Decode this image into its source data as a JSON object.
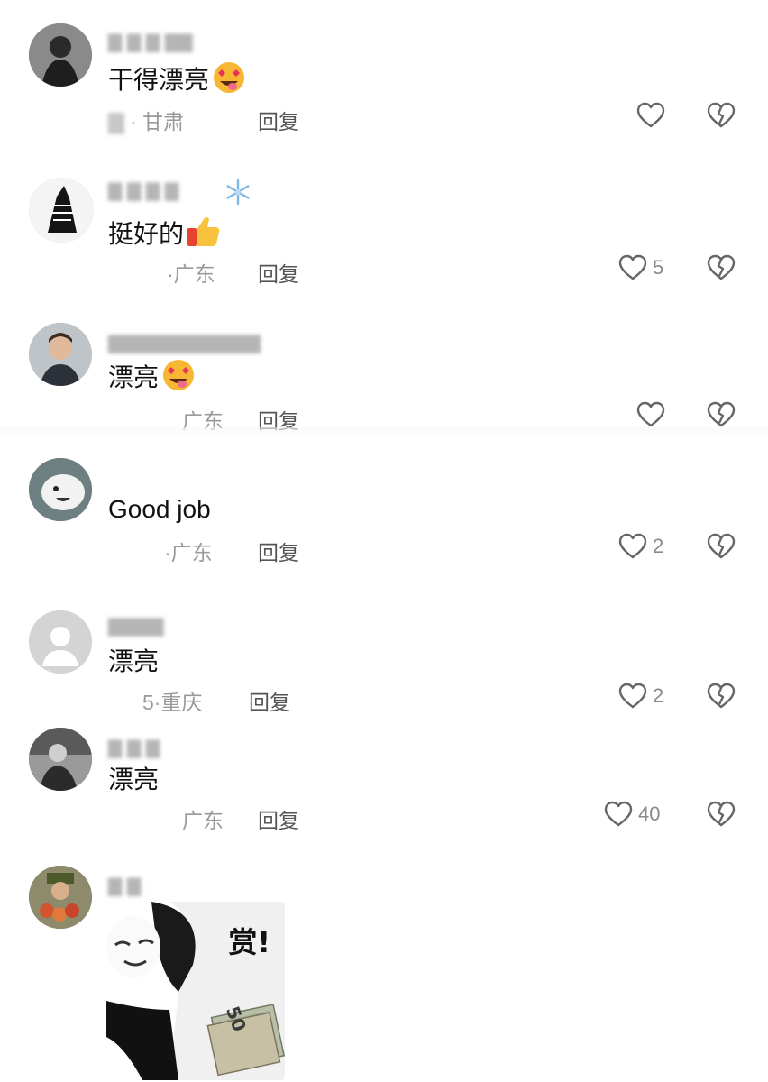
{
  "comments": [
    {
      "username": "▇ ▇ ▇ ▇▇",
      "text": "干得漂亮",
      "emoji": "heart-eyes-tongue-emoji",
      "meta_prefix": "▇",
      "location": "甘肃",
      "reply_label": "回复",
      "likes": ""
    },
    {
      "username": "▇ ▇ ▇ ▇",
      "text": "挺好的",
      "emoji": "thumbs-up-emoji",
      "meta_prefix": "·",
      "location": "广东",
      "reply_label": "回复",
      "likes": "5"
    },
    {
      "username": "▇▇▇▇▇▇▇▇▇▇▇",
      "text": "漂亮",
      "emoji": "heart-eyes-tongue-emoji",
      "meta_prefix": "",
      "location": "广东",
      "reply_label": "回复",
      "likes": ""
    },
    {
      "username": "",
      "text": "Good job",
      "emoji": "",
      "meta_prefix": "·",
      "location": "广东",
      "reply_label": "回复",
      "likes": "2"
    },
    {
      "username": "▇▇▇▇",
      "text": "漂亮",
      "emoji": "",
      "meta_prefix": "5·",
      "location": "重庆",
      "reply_label": "回复",
      "likes": "2"
    },
    {
      "username": "▇ ▇ ▇",
      "text": "漂亮",
      "emoji": "",
      "meta_prefix": "",
      "location": "广东",
      "reply_label": "回复",
      "likes": "40"
    },
    {
      "username": "▇ ▇",
      "sticker_text": "赏!",
      "sticker_note": "50"
    }
  ],
  "colors": {
    "text": "#111111",
    "meta": "#9a9a9a",
    "icon": "#666666"
  }
}
